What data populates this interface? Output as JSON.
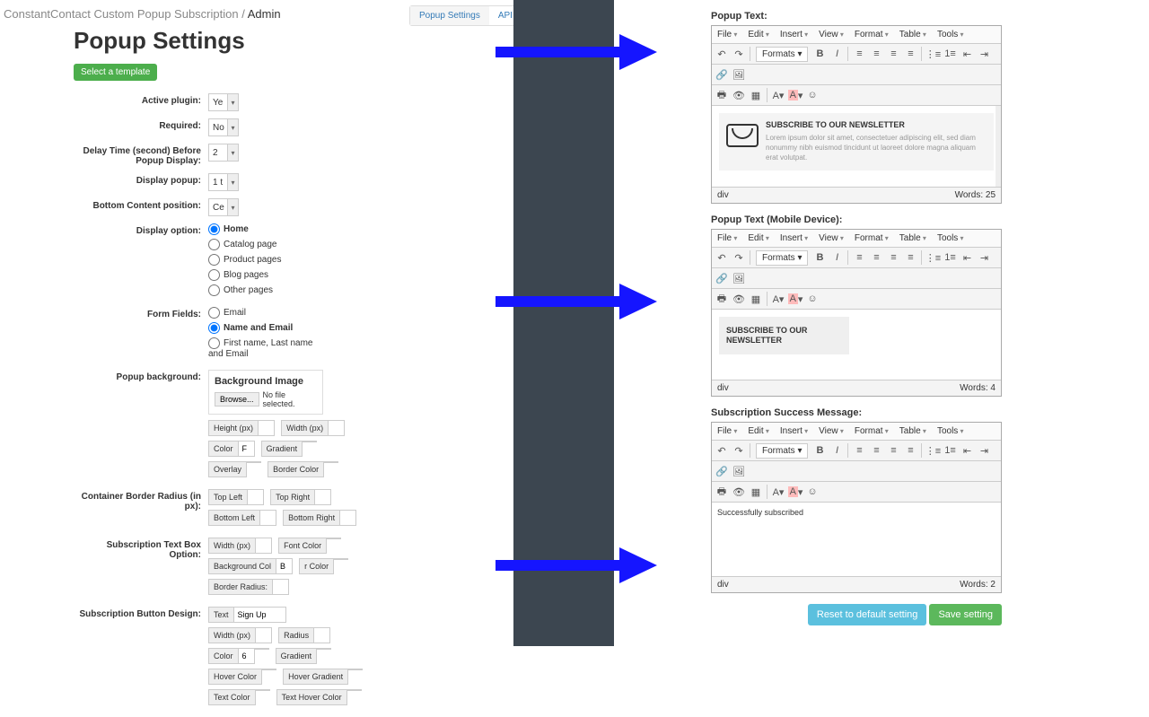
{
  "breadcrumb": {
    "path": "ConstantContact Custom Popup Subscription /",
    "current": "Admin"
  },
  "tabs": [
    "Popup Settings",
    "API Settings"
  ],
  "page_title": "Popup Settings",
  "select_template_btn": "Select a template",
  "fields": {
    "active_plugin": {
      "label": "Active plugin:",
      "value": "Ye"
    },
    "required": {
      "label": "Required:",
      "value": "No"
    },
    "delay": {
      "label": "Delay Time (second) Before Popup Display:",
      "value": "2"
    },
    "display_popup": {
      "label": "Display popup:",
      "value": "1 t"
    },
    "bottom_content": {
      "label": "Bottom Content position:",
      "value": "Ce"
    }
  },
  "display_option": {
    "label": "Display option:",
    "options": [
      "Home",
      "Catalog page",
      "Product pages",
      "Blog pages",
      "Other pages"
    ],
    "selected": 0
  },
  "form_fields": {
    "label": "Form Fields:",
    "options": [
      "Email",
      "Name and Email",
      "First name, Last name and Email"
    ],
    "selected": 1
  },
  "popup_bg": {
    "label": "Popup background:",
    "title": "Background Image",
    "browse": "Browse...",
    "no_file": "No file selected.",
    "height": "Height (px)",
    "width": "Width (px)",
    "color": "Color",
    "color_val": "F",
    "gradient": "Gradient",
    "overlay": "Overlay",
    "overlay_color": "#333",
    "border_color": "Border Color",
    "border_swatch": "#ddd"
  },
  "border_radius": {
    "label": "Container Border Radius (in px):",
    "tl": "Top Left",
    "tr": "Top Right",
    "bl": "Bottom Left",
    "br": "Bottom Right"
  },
  "text_box": {
    "label": "Subscription Text Box Option:",
    "width": "Width (px)",
    "font_color": "Font Color",
    "font_swatch": "#666",
    "bg_color": "Background Col",
    "bg_val": "B",
    "border_color_l": "r Color",
    "border_swatch": "#ddd",
    "border_radius": "Border Radius:"
  },
  "button_design": {
    "label": "Subscription Button Design:",
    "text": "Text",
    "text_val": "Sign Up",
    "width": "Width (px)",
    "radius": "Radius",
    "color": "Color",
    "color_val": "6",
    "color_swatch": "#8b1a1a",
    "gradient": "Gradient",
    "gradient_swatch": "#8b1a1a",
    "hover_color": "Hover Color",
    "hover_swatch": "#d9534f",
    "hover_gradient": "Hover Gradient",
    "hover_grad_swatch": "#d9534f",
    "text_color": "Text Color",
    "text_color_swatch": "#fff",
    "text_hover_color": "Text Hover Color",
    "text_hover_swatch": "#222"
  },
  "editors": {
    "menu": [
      "File",
      "Edit",
      "Insert",
      "View",
      "Format",
      "Table",
      "Tools"
    ],
    "formats": "Formats",
    "popup_text": {
      "label": "Popup Text:",
      "heading": "SUBSCRIBE TO OUR NEWSLETTER",
      "body": "Lorem ipsum dolor sit amet, consectetuer adipiscing elit, sed diam nonummy nibh euismod tincidunt ut laoreet dolore magna aliquam erat volutpat.",
      "path": "div",
      "words": "Words: 25"
    },
    "popup_text_mobile": {
      "label": "Popup Text (Mobile Device):",
      "heading": "SUBSCRIBE TO OUR NEWSLETTER",
      "path": "div",
      "words": "Words: 4"
    },
    "success": {
      "label": "Subscription Success Message:",
      "body": "Successfully subscribed",
      "path": "div",
      "words": "Words: 2"
    }
  },
  "buttons": {
    "reset": "Reset to default setting",
    "save": "Save setting"
  }
}
